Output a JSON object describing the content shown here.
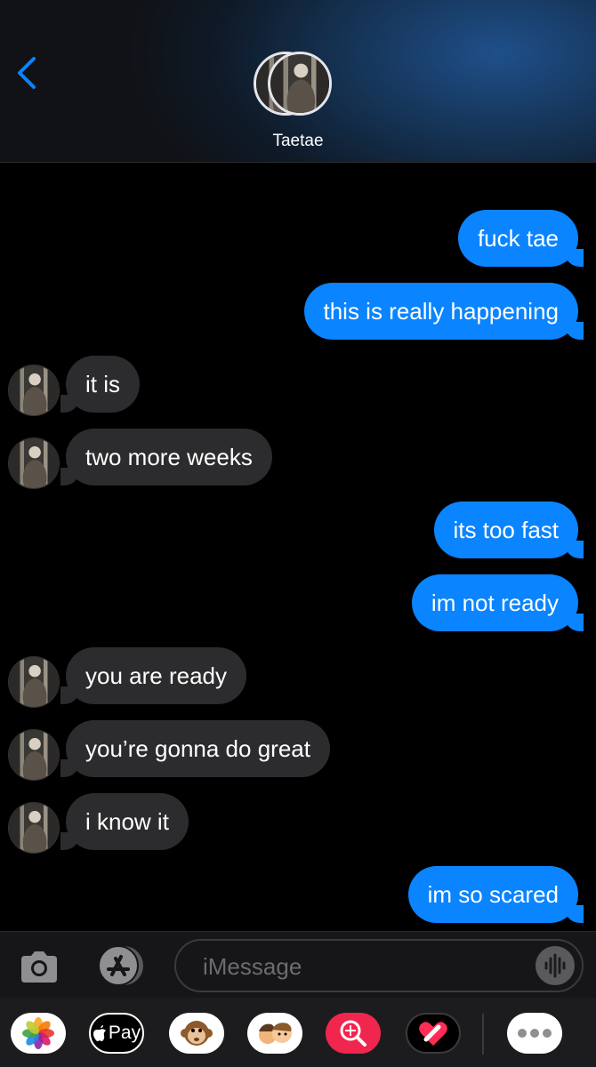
{
  "header": {
    "contact_name": "Taetae"
  },
  "messages": [
    {
      "side": "out",
      "text": "fuck tae"
    },
    {
      "side": "out",
      "text": "this is really happening"
    },
    {
      "side": "in",
      "text": "it is"
    },
    {
      "side": "in",
      "text": "two more weeks"
    },
    {
      "side": "out",
      "text": "its too fast"
    },
    {
      "side": "out",
      "text": "im not ready"
    },
    {
      "side": "in",
      "text": "you are ready"
    },
    {
      "side": "in",
      "text": "you’re gonna do great"
    },
    {
      "side": "in",
      "text": "i know it"
    },
    {
      "side": "out",
      "text": "im so scared"
    }
  ],
  "composer": {
    "placeholder": "iMessage"
  },
  "app_bar": {
    "apple_pay_label": "Pay",
    "icons": [
      "photos-icon",
      "apple-pay-icon",
      "monkey-memoji-icon",
      "memoji-stickers-icon",
      "search-images-icon",
      "digital-touch-icon",
      "more-icon"
    ]
  },
  "colors": {
    "outgoing": "#0a84ff",
    "incoming": "#2c2c2e",
    "background": "#000000"
  }
}
